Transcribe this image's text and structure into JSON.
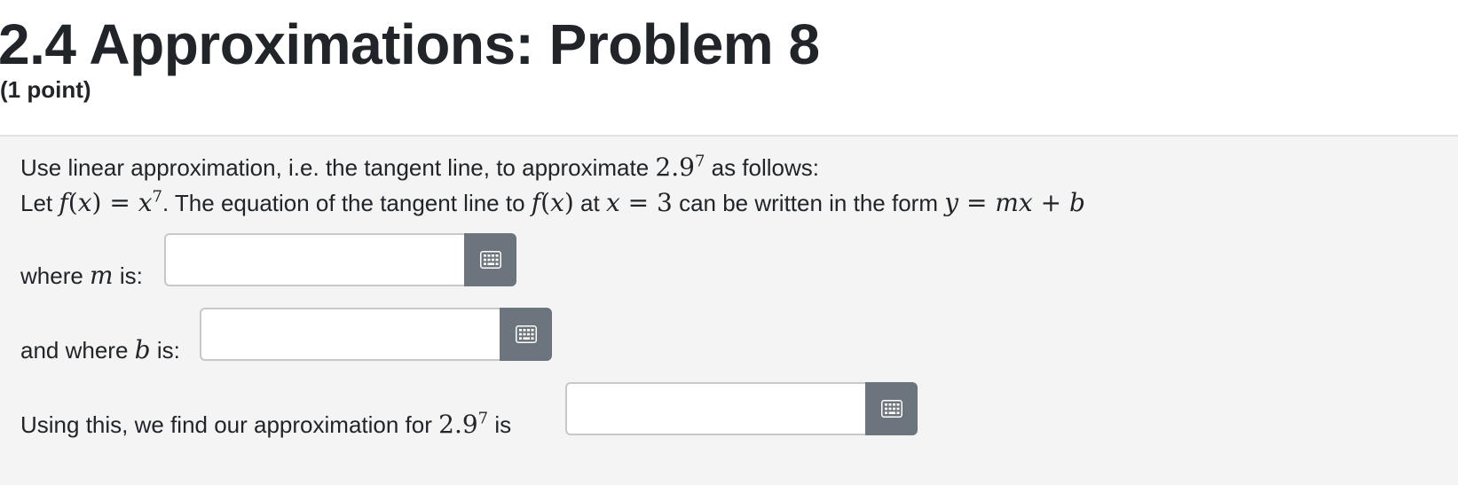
{
  "header": {
    "title": "2.4 Approximations: Problem 8",
    "points": "(1 point)"
  },
  "problem": {
    "line1": {
      "prefix": "Use linear approximation, i.e. the tangent line, to approximate ",
      "base": "2.9",
      "exponent": "7",
      "suffix": " as follows:"
    },
    "line2": {
      "t1": "Let ",
      "f": "f",
      "x1": "x",
      "eq1": " = ",
      "x2": "x",
      "exp": "7",
      "t2": ". The equation of the tangent line to ",
      "f2": "f",
      "x3": "x",
      "t3": " at ",
      "x4": "x",
      "eq2": " = 3",
      "t4": " can be written in the form ",
      "y": "y",
      "eq3": " = ",
      "m": "m",
      "x5": "x",
      "plus": " + ",
      "b": "b"
    },
    "m_row": {
      "t1": "where ",
      "var": "m",
      "t2": " is:",
      "value": "",
      "placeholder": ""
    },
    "b_row": {
      "t1": "and where ",
      "var": "b",
      "t2": " is:",
      "value": "",
      "placeholder": ""
    },
    "approx_row": {
      "t1": "Using this, we find our approximation for ",
      "base": "2.9",
      "exponent": "7",
      "t2": " is",
      "value": "",
      "placeholder": ""
    }
  },
  "icons": {
    "keyboard_button": "keyboard-icon"
  },
  "colors": {
    "button_bg": "#6c757d",
    "problem_bg": "#f4f4f4"
  }
}
